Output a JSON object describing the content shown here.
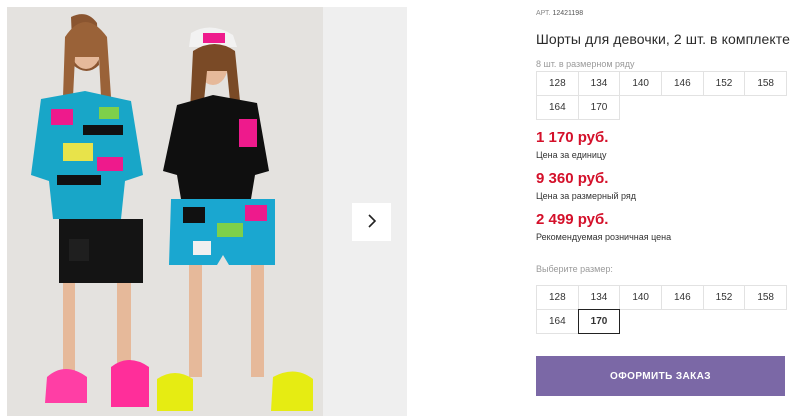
{
  "gallery": {
    "next_icon": "chevron-right-icon"
  },
  "product": {
    "article_label": "АРТ.",
    "article_value": "12421198",
    "title": "Шорты для девочки, 2 шт. в комплекте"
  },
  "size_row": {
    "hint": "8 шт. в размерном ряду",
    "sizes": [
      "128",
      "134",
      "140",
      "146",
      "152",
      "158",
      "164",
      "170"
    ]
  },
  "prices": {
    "unit_price": "1 170 руб.",
    "unit_note": "Цена за единицу",
    "row_price": "9 360 руб.",
    "row_note": "Цена за размерный ряд",
    "retail_price": "2 499 руб.",
    "retail_note": "Рекомендуемая розничная цена"
  },
  "size_select": {
    "label": "Выберите размер:",
    "sizes": [
      "128",
      "134",
      "140",
      "146",
      "152",
      "158",
      "164",
      "170"
    ],
    "selected": "170"
  },
  "order": {
    "button_label": "ОФОРМИТЬ ЗАКАЗ"
  },
  "colors": {
    "price": "#d4102a",
    "button": "#7b68a6"
  }
}
